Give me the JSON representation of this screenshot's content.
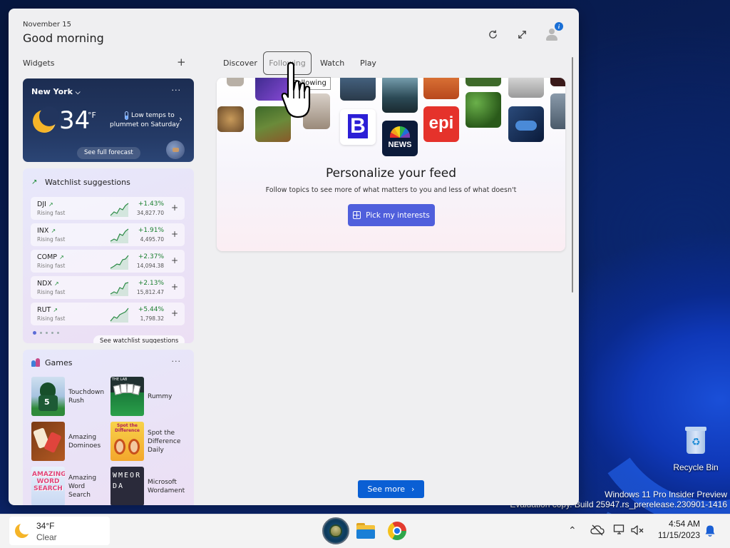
{
  "header": {
    "date": "November 15",
    "greeting": "Good morning"
  },
  "widgets": {
    "label": "Widgets"
  },
  "weather": {
    "city": "New York",
    "temp": "34",
    "unit": "°F",
    "alert_line1": "Low temps to",
    "alert_line2": "plummet on Saturday",
    "forecast_btn": "See full forecast"
  },
  "watchlist": {
    "title": "Watchlist suggestions",
    "see_btn": "See watchlist suggestions",
    "rows": [
      {
        "ticker": "DJI",
        "sub": "Rising fast",
        "change": "+1.43%",
        "value": "34,827.70"
      },
      {
        "ticker": "INX",
        "sub": "Rising fast",
        "change": "+1.91%",
        "value": "4,495.70"
      },
      {
        "ticker": "COMP",
        "sub": "Rising fast",
        "change": "+2.37%",
        "value": "14,094.38"
      },
      {
        "ticker": "NDX",
        "sub": "Rising fast",
        "change": "+2.13%",
        "value": "15,812.47"
      },
      {
        "ticker": "RUT",
        "sub": "Rising fast",
        "change": "+5.44%",
        "value": "1,798.32"
      }
    ]
  },
  "games": {
    "title": "Games",
    "items": [
      {
        "name": "Touchdown Rush",
        "thumb_text": "5"
      },
      {
        "name": "Rummy",
        "thumb_text": "THE LAB"
      },
      {
        "name": "Amazing Dominoes",
        "thumb_text": ""
      },
      {
        "name": "Spot the Difference Daily",
        "thumb_text": "Spot the Difference"
      },
      {
        "name": "Amazing Word Search",
        "thumb_text": "AMAZING WORD SEARCH"
      },
      {
        "name": "Microsoft Wordament",
        "thumb_text": "WMEORDA"
      }
    ]
  },
  "tabs": {
    "discover": "Discover",
    "following": "Following",
    "watch": "Watch",
    "play": "Play",
    "tooltip": "Following"
  },
  "feed": {
    "title": "Personalize your feed",
    "subtitle": "Follow topics to see more of what matters to you and less of what doesn't",
    "button": "Pick my interests",
    "logo_b": "B",
    "logo_news": "NEWS",
    "logo_epi": "epi"
  },
  "see_more": "See more",
  "desktop": {
    "recycle_bin": "Recycle Bin",
    "watermark_line1": "Windows 11 Pro Insider Preview",
    "watermark_line2": "Evaluation copy. Build 25947.rs_prerelease.230901-1416"
  },
  "taskbar": {
    "temp": "34°F",
    "condition": "Clear",
    "time": "4:54 AM",
    "date": "11/15/2023"
  }
}
